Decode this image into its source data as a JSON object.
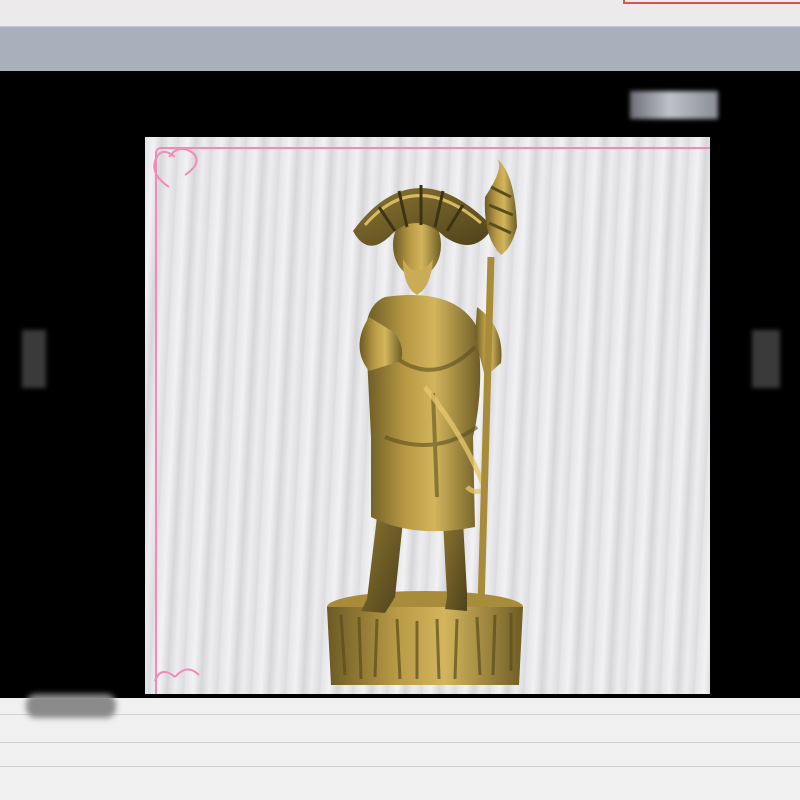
{
  "window": {
    "accent_color": "#d9534f",
    "toolbar_color": "#a7b0bb"
  },
  "viewer": {
    "background": "#000000",
    "prev_icon": "chevron-left-icon",
    "next_icon": "chevron-right-icon"
  },
  "photo": {
    "subject_icon": "fisherman-statue-image",
    "frame_color": "#f08cb8"
  }
}
